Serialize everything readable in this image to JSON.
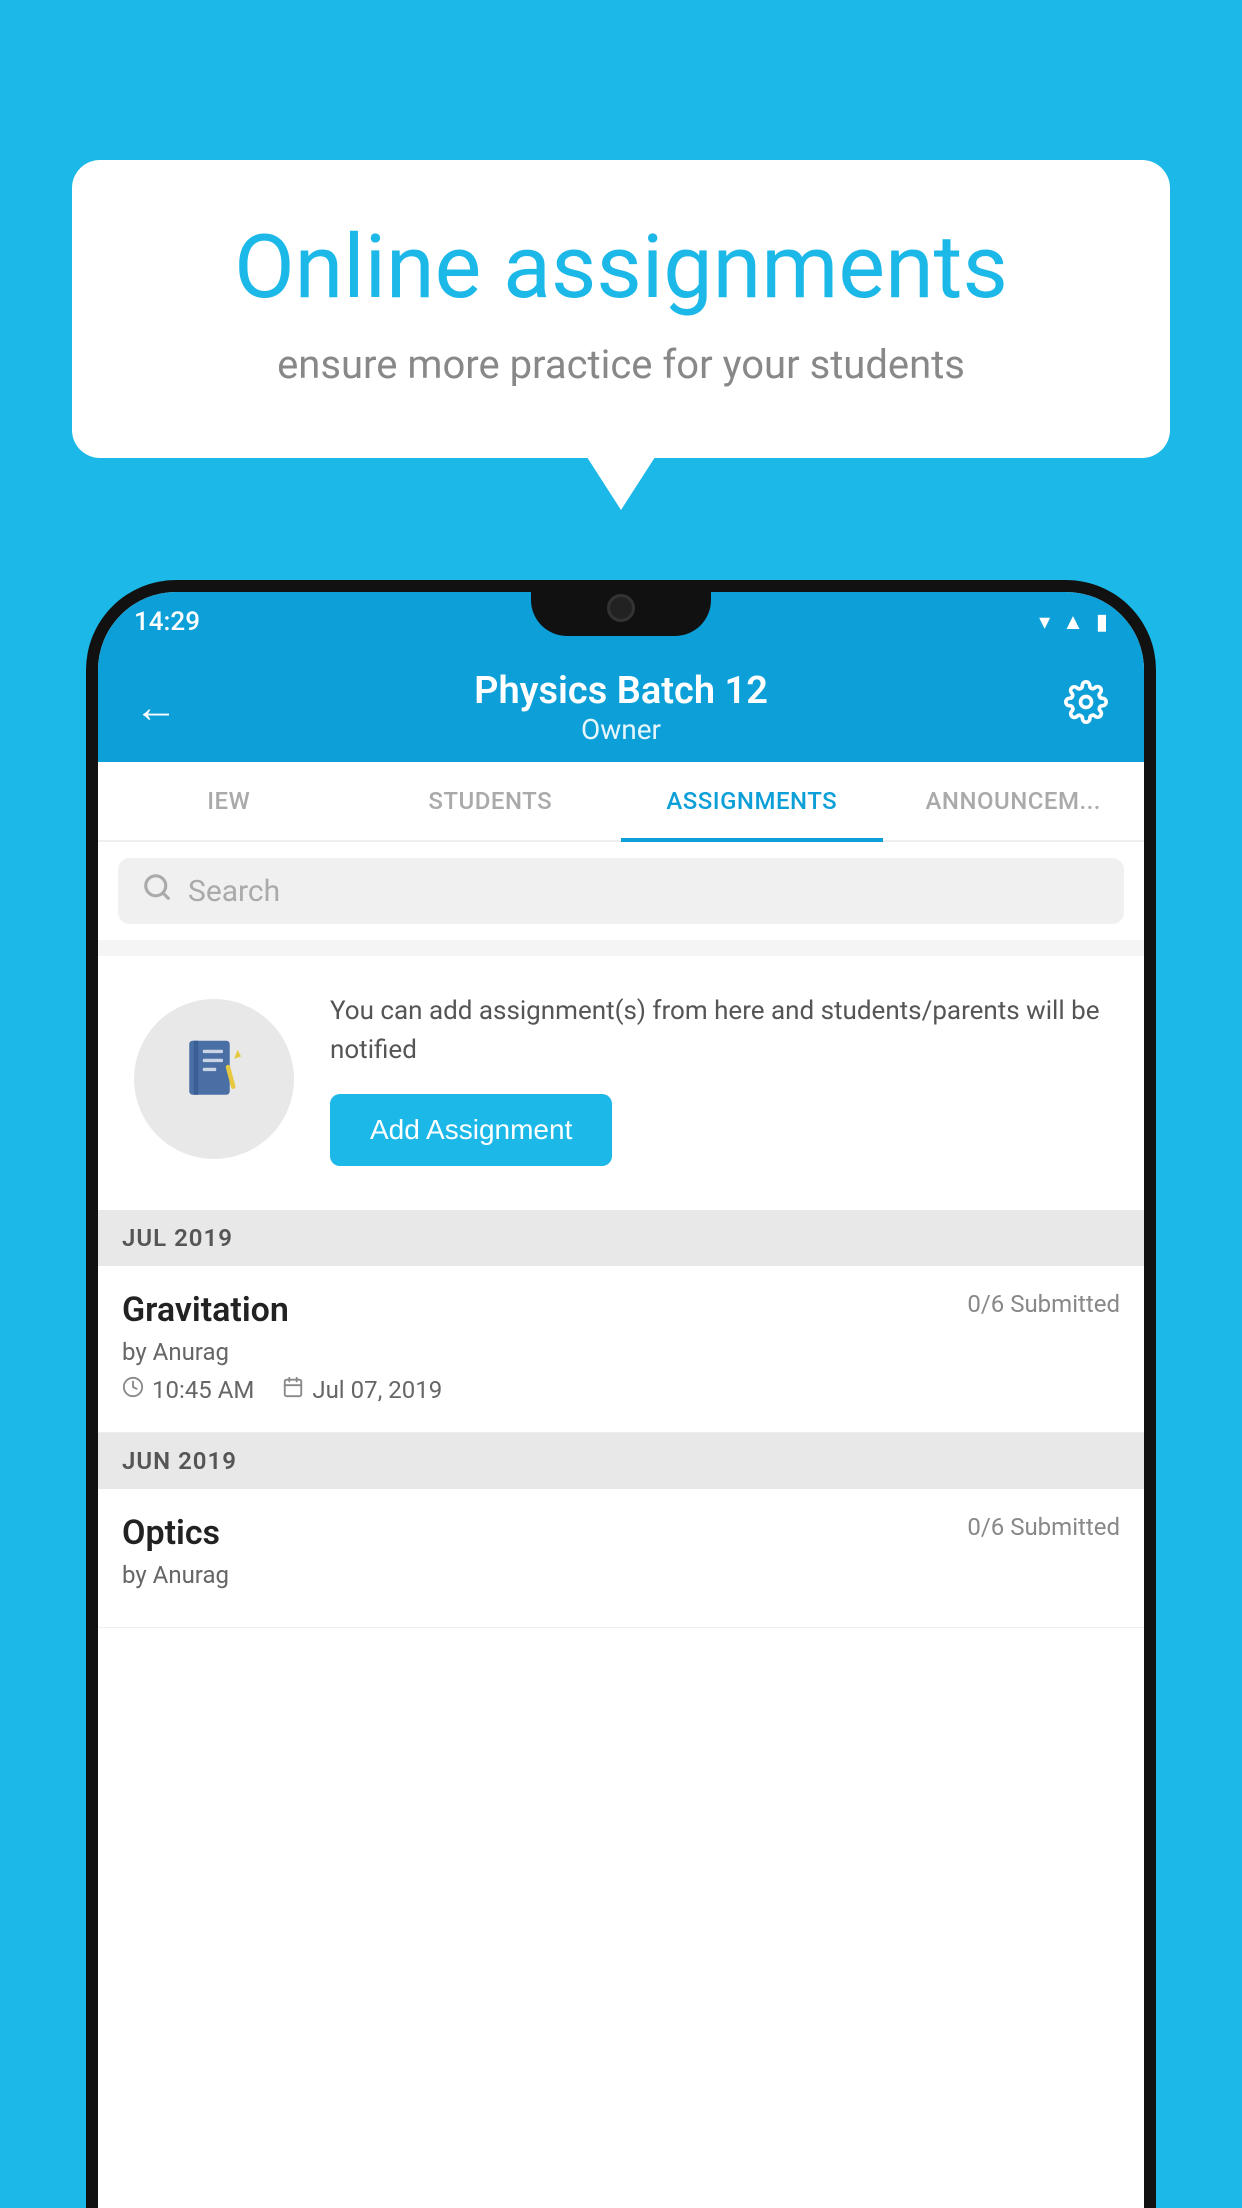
{
  "background_color": "#1bb8e8",
  "speech_bubble": {
    "title": "Online assignments",
    "subtitle": "ensure more practice for your students"
  },
  "phone": {
    "status_bar": {
      "time": "14:29",
      "icons": [
        "wifi",
        "signal",
        "battery"
      ]
    },
    "header": {
      "title": "Physics Batch 12",
      "subtitle": "Owner",
      "back_label": "←",
      "settings_label": "⚙"
    },
    "tabs": [
      {
        "label": "IEW",
        "active": false
      },
      {
        "label": "STUDENTS",
        "active": false
      },
      {
        "label": "ASSIGNMENTS",
        "active": true
      },
      {
        "label": "ANNOUNCEM...",
        "active": false
      }
    ],
    "search": {
      "placeholder": "Search"
    },
    "add_assignment": {
      "description": "You can add assignment(s) from here and students/parents will be notified",
      "button_label": "Add Assignment"
    },
    "sections": [
      {
        "header": "JUL 2019",
        "assignments": [
          {
            "name": "Gravitation",
            "submitted": "0/6 Submitted",
            "by": "by Anurag",
            "time": "10:45 AM",
            "date": "Jul 07, 2019"
          }
        ]
      },
      {
        "header": "JUN 2019",
        "assignments": [
          {
            "name": "Optics",
            "submitted": "0/6 Submitted",
            "by": "by Anurag",
            "time": "",
            "date": ""
          }
        ]
      }
    ]
  }
}
